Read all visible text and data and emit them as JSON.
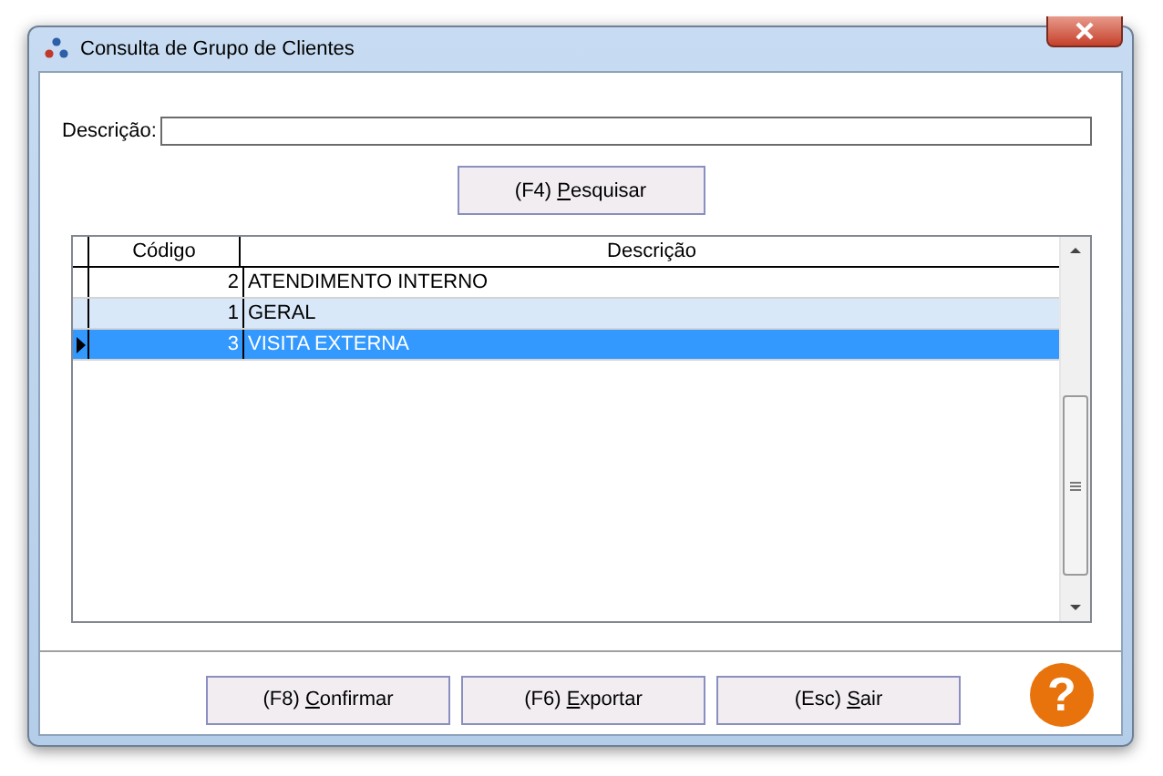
{
  "window": {
    "title": "Consulta de Grupo de Clientes"
  },
  "search": {
    "label": "Descrição:"
  },
  "search_button": {
    "before": "(F4) ",
    "access_key": "P",
    "after": "esquisar"
  },
  "table": {
    "columns": [
      "Código",
      "Descrição"
    ],
    "rows": [
      {
        "codigo": "2",
        "descricao": "ATENDIMENTO INTERNO",
        "highlighted": false,
        "selected": false
      },
      {
        "codigo": "1",
        "descricao": "GERAL",
        "highlighted": true,
        "selected": false
      },
      {
        "codigo": "3",
        "descricao": "VISITA EXTERNA",
        "highlighted": false,
        "selected": true
      }
    ]
  },
  "buttons": [
    {
      "before": "(F8) ",
      "access_key": "C",
      "after": "onfirmar"
    },
    {
      "before": "(F6) ",
      "access_key": "E",
      "after": "xportar"
    },
    {
      "before": "(Esc) ",
      "access_key": "S",
      "after": "air"
    }
  ],
  "help": {
    "symbol": "?"
  }
}
